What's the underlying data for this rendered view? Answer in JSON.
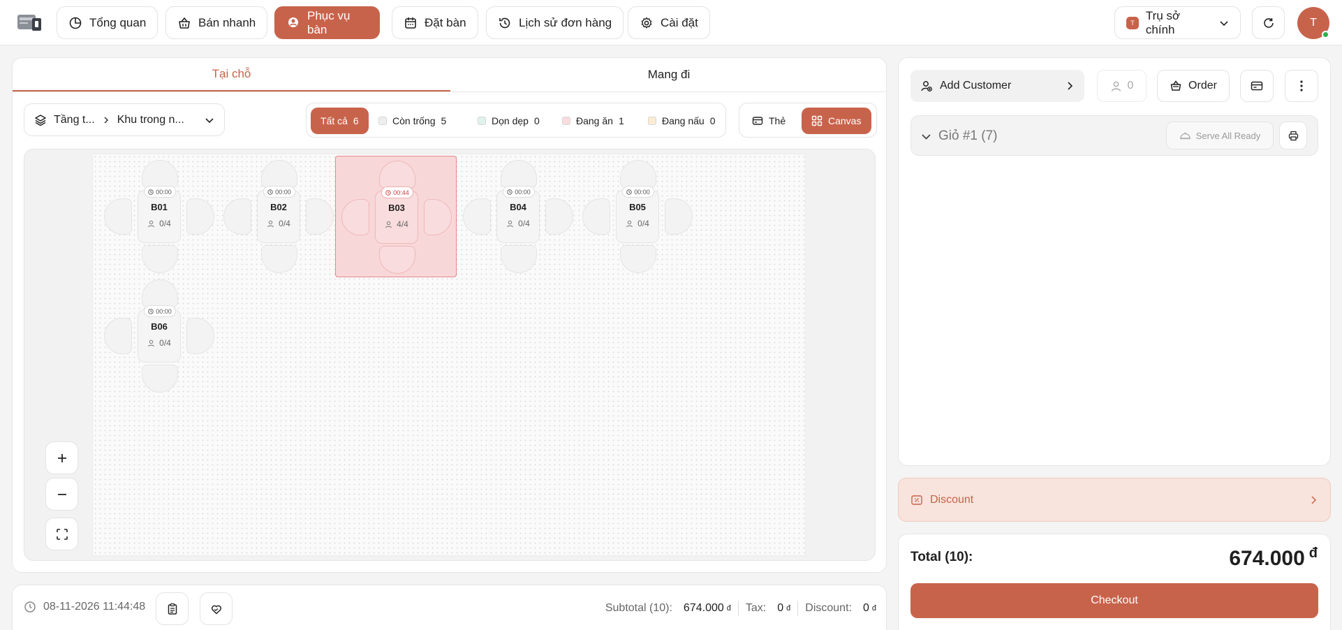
{
  "nav": {
    "items": [
      {
        "label": "Tổng quan",
        "icon": "pie-chart-icon"
      },
      {
        "label": "Bán nhanh",
        "icon": "basket-icon"
      },
      {
        "label": "Phục vụ bàn",
        "icon": "waiter-icon"
      },
      {
        "label": "Đặt bàn",
        "icon": "calendar-icon"
      },
      {
        "label": "Lịch sử đơn hàng",
        "icon": "history-icon"
      },
      {
        "label": "Cài đặt",
        "icon": "gear-icon"
      }
    ],
    "active": "Phục vụ bàn",
    "branch_badge": "T",
    "branch": "Trụ sở chính",
    "avatar_initial": "T"
  },
  "tabs": [
    {
      "label": "Tại chỗ",
      "active": true
    },
    {
      "label": "Mang đi",
      "active": false
    }
  ],
  "floor": {
    "floor_label": "Tầng t...",
    "area_label": "Khu trong n..."
  },
  "filters": [
    {
      "label": "Tất cả",
      "count": "6",
      "color": "#c8634b",
      "active": true
    },
    {
      "label": "Còn trống",
      "count": "5",
      "color": "#eeeeee"
    },
    {
      "label": "Dọn dẹp",
      "count": "0",
      "color": "#dff3ea"
    },
    {
      "label": "Đang ăn",
      "count": "1",
      "color": "#f9dcdd"
    },
    {
      "label": "Đang nấu",
      "count": "0",
      "color": "#fbecd3"
    }
  ],
  "view_modes": [
    {
      "label": "Thẻ",
      "active": false
    },
    {
      "label": "Canvas",
      "active": true
    }
  ],
  "tables": [
    {
      "name": "B01",
      "timer": "00:00",
      "guests": "0/4",
      "status": "available"
    },
    {
      "name": "B02",
      "timer": "00:00",
      "guests": "0/4",
      "status": "available"
    },
    {
      "name": "B03",
      "timer": "00:44",
      "guests": "4/4",
      "status": "eating"
    },
    {
      "name": "B04",
      "timer": "00:00",
      "guests": "0/4",
      "status": "available"
    },
    {
      "name": "B05",
      "timer": "00:00",
      "guests": "0/4",
      "status": "available"
    },
    {
      "name": "B06",
      "timer": "00:00",
      "guests": "0/4",
      "status": "available"
    }
  ],
  "bottom": {
    "datetime": "08-11-2026 11:44:48",
    "subtotal_label": "Subtotal (10):",
    "subtotal_value": "674.000",
    "tax_label": "Tax:",
    "tax_value": "0",
    "discount_label": "Discount:",
    "discount_value": "0",
    "currency": "đ"
  },
  "order": {
    "add_customer_label": "Add Customer",
    "guest_count": "0",
    "order_label": "Order",
    "cart_title": "Giỏ #1 (7)",
    "serve_all_label": "Serve All Ready",
    "discount_label": "Discount",
    "total_label": "Total (10):",
    "total_value": "674.000",
    "currency": "đ",
    "checkout_label": "Checkout"
  },
  "colors": {
    "accent": "#c8634b",
    "eating": "#f8d7d8",
    "online": "#2bb24c"
  }
}
